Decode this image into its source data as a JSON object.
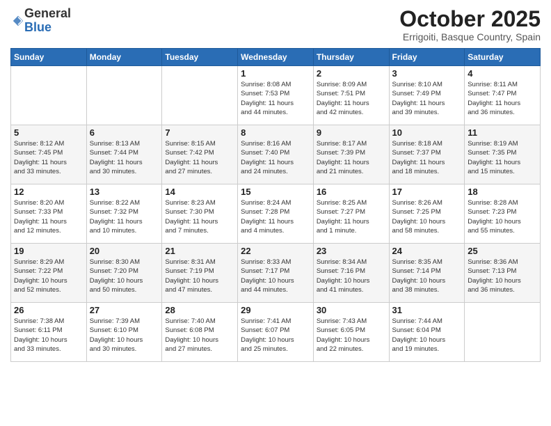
{
  "header": {
    "logo_general": "General",
    "logo_blue": "Blue",
    "month_title": "October 2025",
    "subtitle": "Errigoiti, Basque Country, Spain"
  },
  "days_of_week": [
    "Sunday",
    "Monday",
    "Tuesday",
    "Wednesday",
    "Thursday",
    "Friday",
    "Saturday"
  ],
  "weeks": [
    [
      {
        "day": "",
        "info": ""
      },
      {
        "day": "",
        "info": ""
      },
      {
        "day": "",
        "info": ""
      },
      {
        "day": "1",
        "info": "Sunrise: 8:08 AM\nSunset: 7:53 PM\nDaylight: 11 hours\nand 44 minutes."
      },
      {
        "day": "2",
        "info": "Sunrise: 8:09 AM\nSunset: 7:51 PM\nDaylight: 11 hours\nand 42 minutes."
      },
      {
        "day": "3",
        "info": "Sunrise: 8:10 AM\nSunset: 7:49 PM\nDaylight: 11 hours\nand 39 minutes."
      },
      {
        "day": "4",
        "info": "Sunrise: 8:11 AM\nSunset: 7:47 PM\nDaylight: 11 hours\nand 36 minutes."
      }
    ],
    [
      {
        "day": "5",
        "info": "Sunrise: 8:12 AM\nSunset: 7:45 PM\nDaylight: 11 hours\nand 33 minutes."
      },
      {
        "day": "6",
        "info": "Sunrise: 8:13 AM\nSunset: 7:44 PM\nDaylight: 11 hours\nand 30 minutes."
      },
      {
        "day": "7",
        "info": "Sunrise: 8:15 AM\nSunset: 7:42 PM\nDaylight: 11 hours\nand 27 minutes."
      },
      {
        "day": "8",
        "info": "Sunrise: 8:16 AM\nSunset: 7:40 PM\nDaylight: 11 hours\nand 24 minutes."
      },
      {
        "day": "9",
        "info": "Sunrise: 8:17 AM\nSunset: 7:39 PM\nDaylight: 11 hours\nand 21 minutes."
      },
      {
        "day": "10",
        "info": "Sunrise: 8:18 AM\nSunset: 7:37 PM\nDaylight: 11 hours\nand 18 minutes."
      },
      {
        "day": "11",
        "info": "Sunrise: 8:19 AM\nSunset: 7:35 PM\nDaylight: 11 hours\nand 15 minutes."
      }
    ],
    [
      {
        "day": "12",
        "info": "Sunrise: 8:20 AM\nSunset: 7:33 PM\nDaylight: 11 hours\nand 12 minutes."
      },
      {
        "day": "13",
        "info": "Sunrise: 8:22 AM\nSunset: 7:32 PM\nDaylight: 11 hours\nand 10 minutes."
      },
      {
        "day": "14",
        "info": "Sunrise: 8:23 AM\nSunset: 7:30 PM\nDaylight: 11 hours\nand 7 minutes."
      },
      {
        "day": "15",
        "info": "Sunrise: 8:24 AM\nSunset: 7:28 PM\nDaylight: 11 hours\nand 4 minutes."
      },
      {
        "day": "16",
        "info": "Sunrise: 8:25 AM\nSunset: 7:27 PM\nDaylight: 11 hours\nand 1 minute."
      },
      {
        "day": "17",
        "info": "Sunrise: 8:26 AM\nSunset: 7:25 PM\nDaylight: 10 hours\nand 58 minutes."
      },
      {
        "day": "18",
        "info": "Sunrise: 8:28 AM\nSunset: 7:23 PM\nDaylight: 10 hours\nand 55 minutes."
      }
    ],
    [
      {
        "day": "19",
        "info": "Sunrise: 8:29 AM\nSunset: 7:22 PM\nDaylight: 10 hours\nand 52 minutes."
      },
      {
        "day": "20",
        "info": "Sunrise: 8:30 AM\nSunset: 7:20 PM\nDaylight: 10 hours\nand 50 minutes."
      },
      {
        "day": "21",
        "info": "Sunrise: 8:31 AM\nSunset: 7:19 PM\nDaylight: 10 hours\nand 47 minutes."
      },
      {
        "day": "22",
        "info": "Sunrise: 8:33 AM\nSunset: 7:17 PM\nDaylight: 10 hours\nand 44 minutes."
      },
      {
        "day": "23",
        "info": "Sunrise: 8:34 AM\nSunset: 7:16 PM\nDaylight: 10 hours\nand 41 minutes."
      },
      {
        "day": "24",
        "info": "Sunrise: 8:35 AM\nSunset: 7:14 PM\nDaylight: 10 hours\nand 38 minutes."
      },
      {
        "day": "25",
        "info": "Sunrise: 8:36 AM\nSunset: 7:13 PM\nDaylight: 10 hours\nand 36 minutes."
      }
    ],
    [
      {
        "day": "26",
        "info": "Sunrise: 7:38 AM\nSunset: 6:11 PM\nDaylight: 10 hours\nand 33 minutes."
      },
      {
        "day": "27",
        "info": "Sunrise: 7:39 AM\nSunset: 6:10 PM\nDaylight: 10 hours\nand 30 minutes."
      },
      {
        "day": "28",
        "info": "Sunrise: 7:40 AM\nSunset: 6:08 PM\nDaylight: 10 hours\nand 27 minutes."
      },
      {
        "day": "29",
        "info": "Sunrise: 7:41 AM\nSunset: 6:07 PM\nDaylight: 10 hours\nand 25 minutes."
      },
      {
        "day": "30",
        "info": "Sunrise: 7:43 AM\nSunset: 6:05 PM\nDaylight: 10 hours\nand 22 minutes."
      },
      {
        "day": "31",
        "info": "Sunrise: 7:44 AM\nSunset: 6:04 PM\nDaylight: 10 hours\nand 19 minutes."
      },
      {
        "day": "",
        "info": ""
      }
    ]
  ]
}
